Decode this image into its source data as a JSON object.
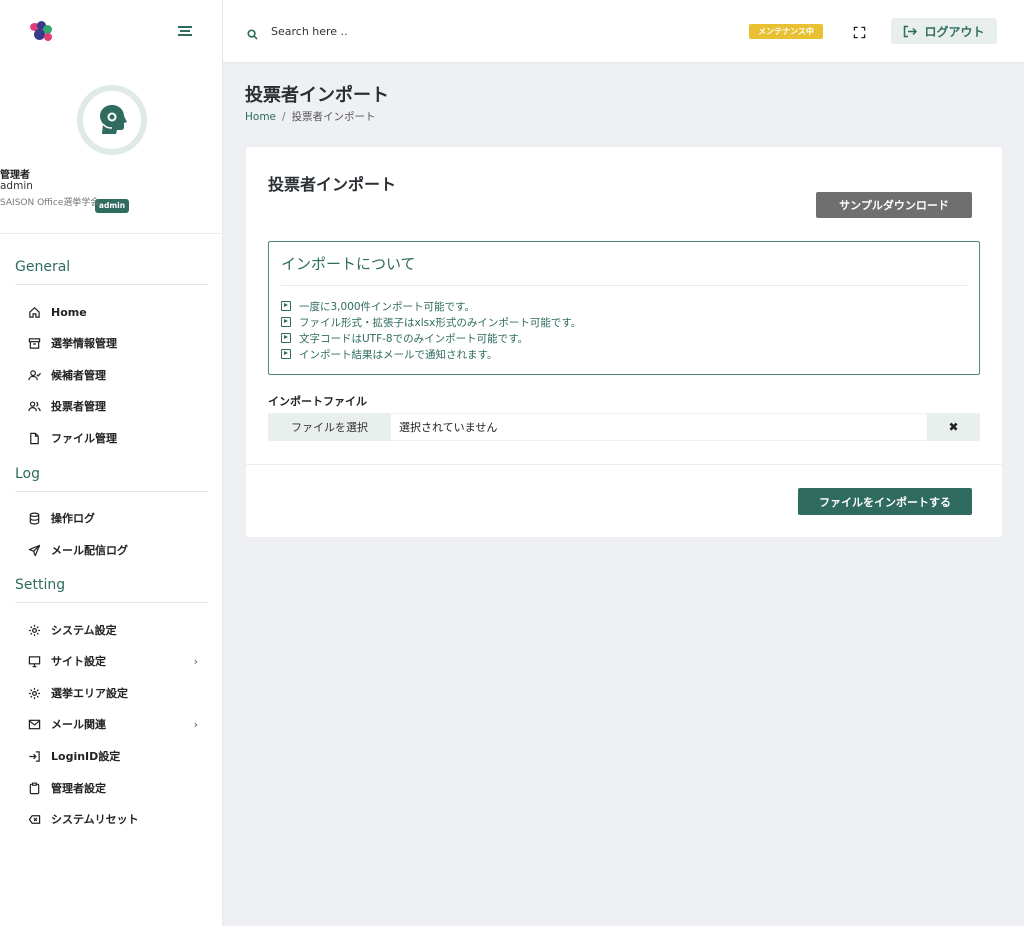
{
  "topbar": {
    "search_placeholder": "Search here ..",
    "maintenance_badge": "メンテナンス中",
    "logout_label": "ログアウト"
  },
  "profile": {
    "role_badge": "admin",
    "name": "管理者",
    "login_id": "admin",
    "organization": "SAISON Office選挙学会"
  },
  "sidebar": {
    "sections": [
      {
        "title": "General",
        "items": [
          {
            "label": "Home",
            "icon": "home-icon"
          },
          {
            "label": "選挙情報管理",
            "icon": "archive-icon"
          },
          {
            "label": "候補者管理",
            "icon": "user-check-icon"
          },
          {
            "label": "投票者管理",
            "icon": "users-icon"
          },
          {
            "label": "ファイル管理",
            "icon": "file-icon"
          }
        ]
      },
      {
        "title": "Log",
        "items": [
          {
            "label": "操作ログ",
            "icon": "database-icon"
          },
          {
            "label": "メール配信ログ",
            "icon": "send-icon"
          }
        ]
      },
      {
        "title": "Setting",
        "items": [
          {
            "label": "システム設定",
            "icon": "gear-icon"
          },
          {
            "label": "サイト設定",
            "icon": "monitor-icon",
            "has_submenu": true
          },
          {
            "label": "選挙エリア設定",
            "icon": "gear-icon"
          },
          {
            "label": "メール関連",
            "icon": "mail-icon",
            "has_submenu": true
          },
          {
            "label": "LoginID設定",
            "icon": "login-icon"
          },
          {
            "label": "管理者設定",
            "icon": "clipboard-icon"
          },
          {
            "label": "システムリセット",
            "icon": "backspace-icon"
          }
        ]
      }
    ]
  },
  "header": {
    "title": "投票者インポート",
    "breadcrumb": [
      "Home",
      "投票者インポート"
    ]
  },
  "card": {
    "title": "投票者インポート",
    "sample_download_label": "サンプルダウンロード",
    "info": {
      "title": "インポートについて",
      "items": [
        "一度に3,000件インポート可能です。",
        "ファイル形式・拡張子はxlsx形式のみインポート可能です。",
        "文字コードはUTF-8でのみインポート可能です。",
        "インポート結果はメールで通知されます。"
      ]
    },
    "file_label": "インポートファイル",
    "file_choose_label": "ファイルを選択",
    "file_name": "選択されていません",
    "clear_symbol": "✖",
    "import_button_label": "ファイルをインポートする"
  },
  "colors": {
    "accent": "#2f6b5e",
    "maintenance": "#e8c032",
    "sample_button": "#6f6f6f",
    "background": "#eef0f4"
  }
}
